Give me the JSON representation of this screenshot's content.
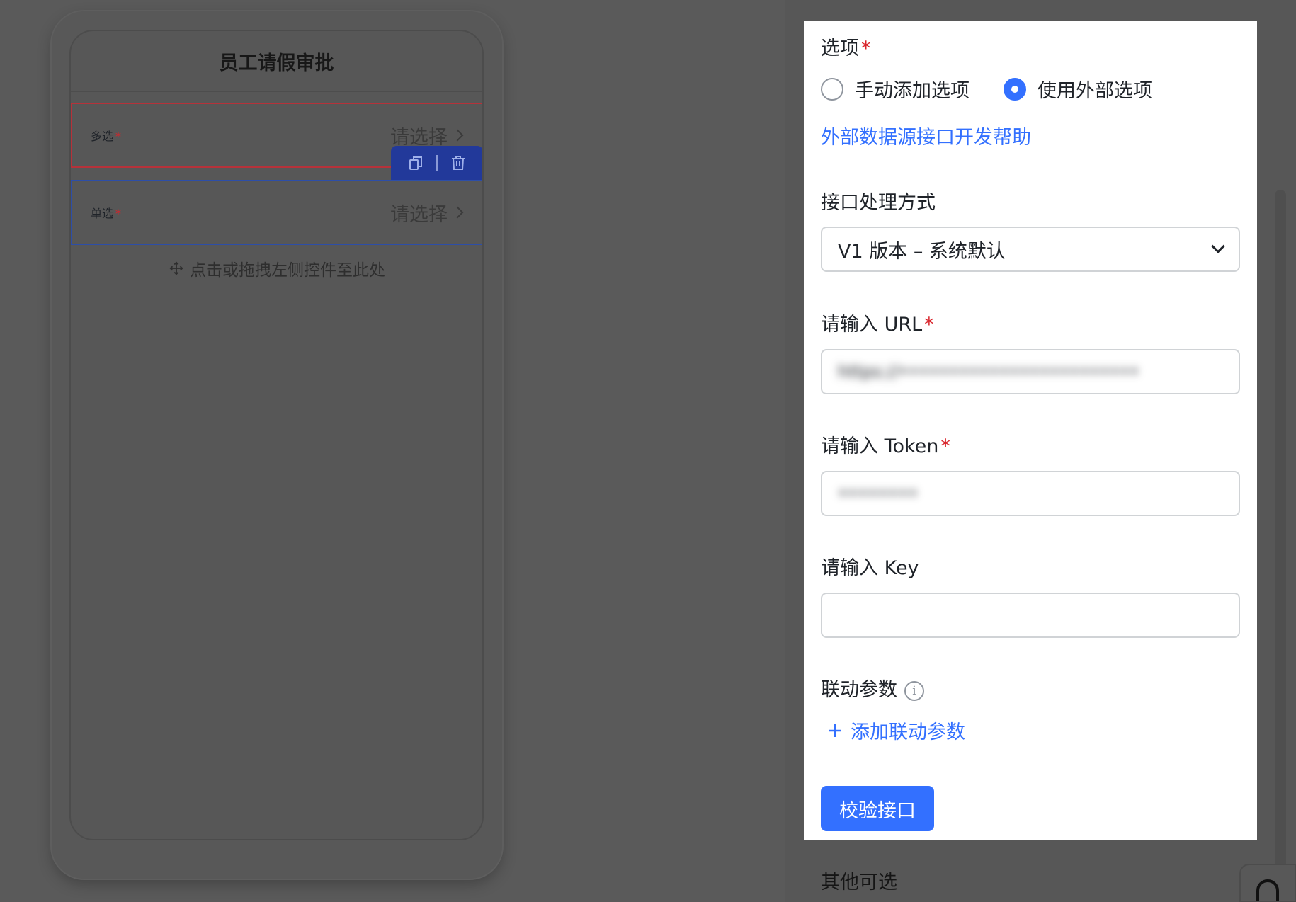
{
  "canvas": {
    "form_title": "员工请假审批",
    "fields": [
      {
        "label": "多选",
        "placeholder": "请选择"
      },
      {
        "label": "单选",
        "placeholder": "请选择"
      }
    ],
    "drop_hint": "点击或拖拽左侧控件至此处",
    "required_mark": "*"
  },
  "panel": {
    "options_label": "选项",
    "required_mark": "*",
    "radio_manual": "手动添加选项",
    "radio_external": "使用外部选项",
    "selected_radio": "使用外部选项",
    "help_link": "外部数据源接口开发帮助",
    "method_label": "接口处理方式",
    "method_value": "V1 版本 – 系统默认",
    "url_label": "请输入 URL",
    "url_value": "https://••••••••••••••••••••••••",
    "token_label": "请输入 Token",
    "token_value": "••••••••",
    "key_label": "请输入 Key",
    "key_value": "",
    "linkage_label": "联动参数",
    "add_linkage": "添加联动参数",
    "verify_button": "校验接口"
  },
  "other_label": "其他可选",
  "colors": {
    "primary": "#3370ff",
    "required": "#d8232a",
    "selected_border": "#b6323a",
    "hover_border": "#2d4ea8"
  }
}
